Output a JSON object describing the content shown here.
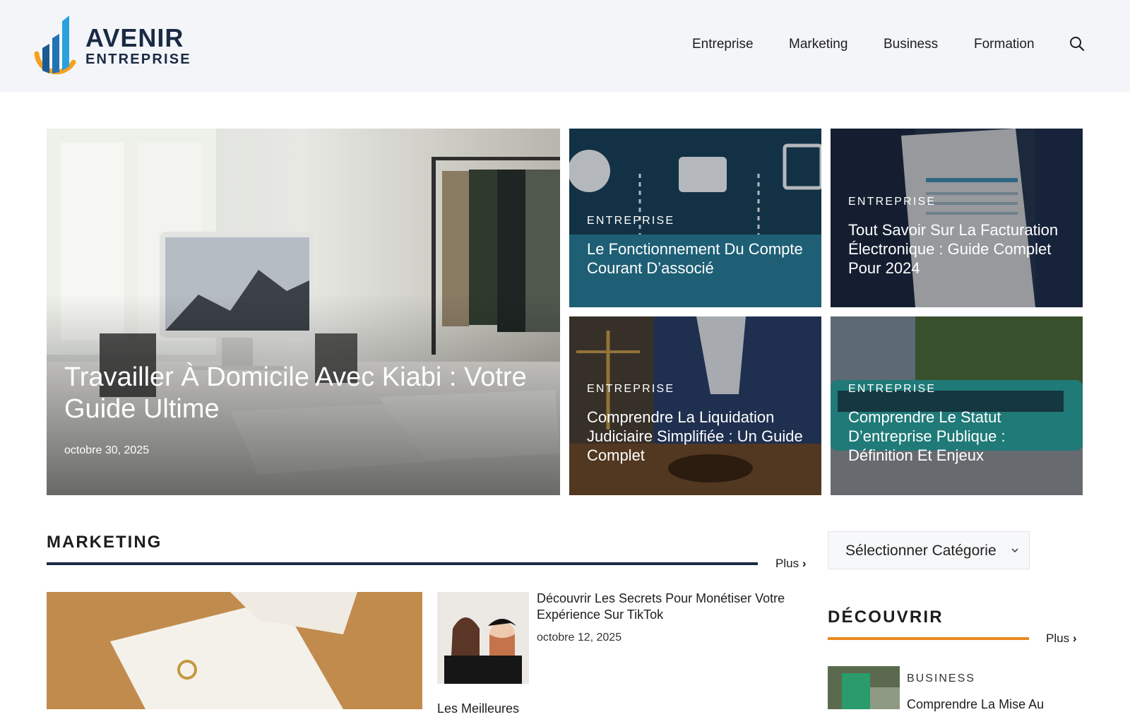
{
  "brand": {
    "line1": "AVENIR",
    "line2": "ENTREPRISE"
  },
  "nav": {
    "items": [
      {
        "label": "Entreprise"
      },
      {
        "label": "Marketing"
      },
      {
        "label": "Business"
      },
      {
        "label": "Formation"
      }
    ],
    "search_icon": "search-icon"
  },
  "hero": {
    "main": {
      "title": "Travailler À Domicile Avec Kiabi : Votre Guide Ultime",
      "date": "octobre 30, 2025"
    },
    "cards": [
      {
        "category": "ENTREPRISE",
        "title": "Le Fonctionnement Du Compte Courant D’associé"
      },
      {
        "category": "ENTREPRISE",
        "title": "Tout Savoir Sur La Facturation Électronique : Guide Complet Pour 2024"
      },
      {
        "category": "ENTREPRISE",
        "title": "Comprendre La Liquidation Judiciaire Simplifiée : Un Guide Complet"
      },
      {
        "category": "ENTREPRISE",
        "title": "Comprendre Le Statut D’entreprise Publique : Définition Et Enjeux"
      }
    ]
  },
  "marketing": {
    "heading": "MARKETING",
    "more": "Plus",
    "posts": [
      {
        "title": "Découvrir Les Secrets Pour Monétiser Votre Expérience Sur TikTok",
        "date": "octobre 12, 2025"
      },
      {
        "title": "Les Meilleures"
      }
    ]
  },
  "sidebar": {
    "select_label": "Sélectionner Catégorie",
    "discover_heading": "DÉCOUVRIR",
    "more": "Plus",
    "posts": [
      {
        "category": "BUSINESS",
        "title": "Comprendre La Mise Au"
      }
    ]
  },
  "colors": {
    "header_bg": "#f3f5f8",
    "marketing_rule": "#1b2a44",
    "discover_rule": "#e8891f",
    "card_shade": "#1c3146"
  }
}
